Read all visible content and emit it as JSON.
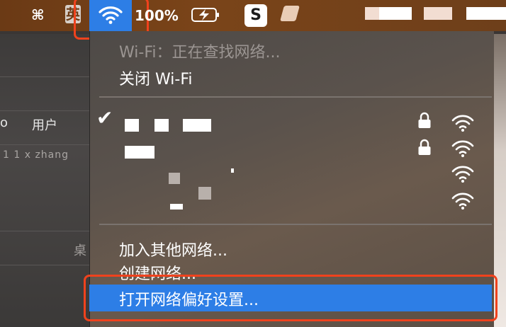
{
  "menubar": {
    "cmd_icon": "⌘",
    "input_method": "英",
    "wifi_icon": "wifi-icon",
    "battery_percent": "100%",
    "sogou_label": "S"
  },
  "background_window": {
    "column_user": "用户",
    "column_o": "o",
    "faint_text": "1 1  x zhang",
    "desk_label": "桌"
  },
  "wifi_menu": {
    "status": "Wi-Fi：正在查找网络...",
    "turn_off": "关闭 Wi-Fi",
    "join_other": "加入其他网络...",
    "create_network": "创建网络...",
    "open_preferences": "打开网络偏好设置..."
  },
  "colors": {
    "highlight": "#2d7ee6",
    "annotation_red": "#f0421d"
  }
}
